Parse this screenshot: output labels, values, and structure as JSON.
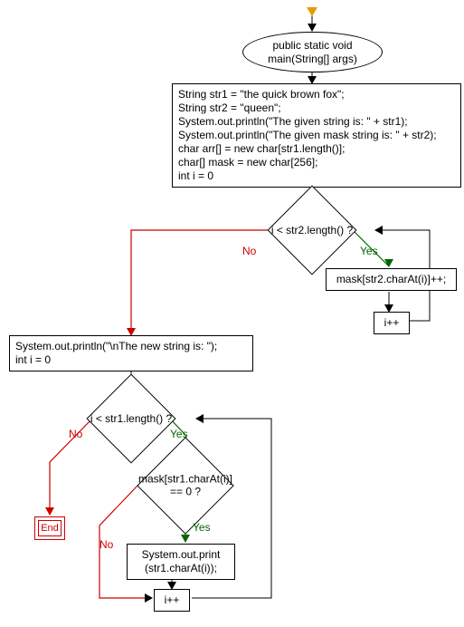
{
  "start": {
    "label": "public static void\nmain(String[] args)"
  },
  "init_block": {
    "lines": [
      "String str1 = \"the quick brown fox\";",
      "String str2 = \"queen\";",
      "System.out.println(\"The given string is: \" + str1);",
      "System.out.println(\"The given mask string is: \" + str2);",
      "char arr[] = new char[str1.length()];",
      "char[] mask = new char[256];",
      "int i = 0"
    ]
  },
  "cond1": {
    "label": "i < str2.length() ?",
    "yes": "Yes",
    "no": "No"
  },
  "stmt_mask": {
    "label": "mask[str2.charAt(i)]++;"
  },
  "inc1": {
    "label": "i++"
  },
  "print_header": {
    "lines": [
      "System.out.println(\"\\nThe new string is: \");",
      "int i = 0"
    ]
  },
  "cond2": {
    "label": "i < str1.length() ?",
    "yes": "Yes",
    "no": "No"
  },
  "cond3": {
    "line1": "mask[str1.charAt(i)]",
    "line2": "== 0 ?",
    "yes": "Yes",
    "no": "No"
  },
  "stmt_print": {
    "line1": "System.out.print",
    "line2": "(str1.charAt(i));"
  },
  "inc2": {
    "label": "i++"
  },
  "end": {
    "label": "End"
  }
}
